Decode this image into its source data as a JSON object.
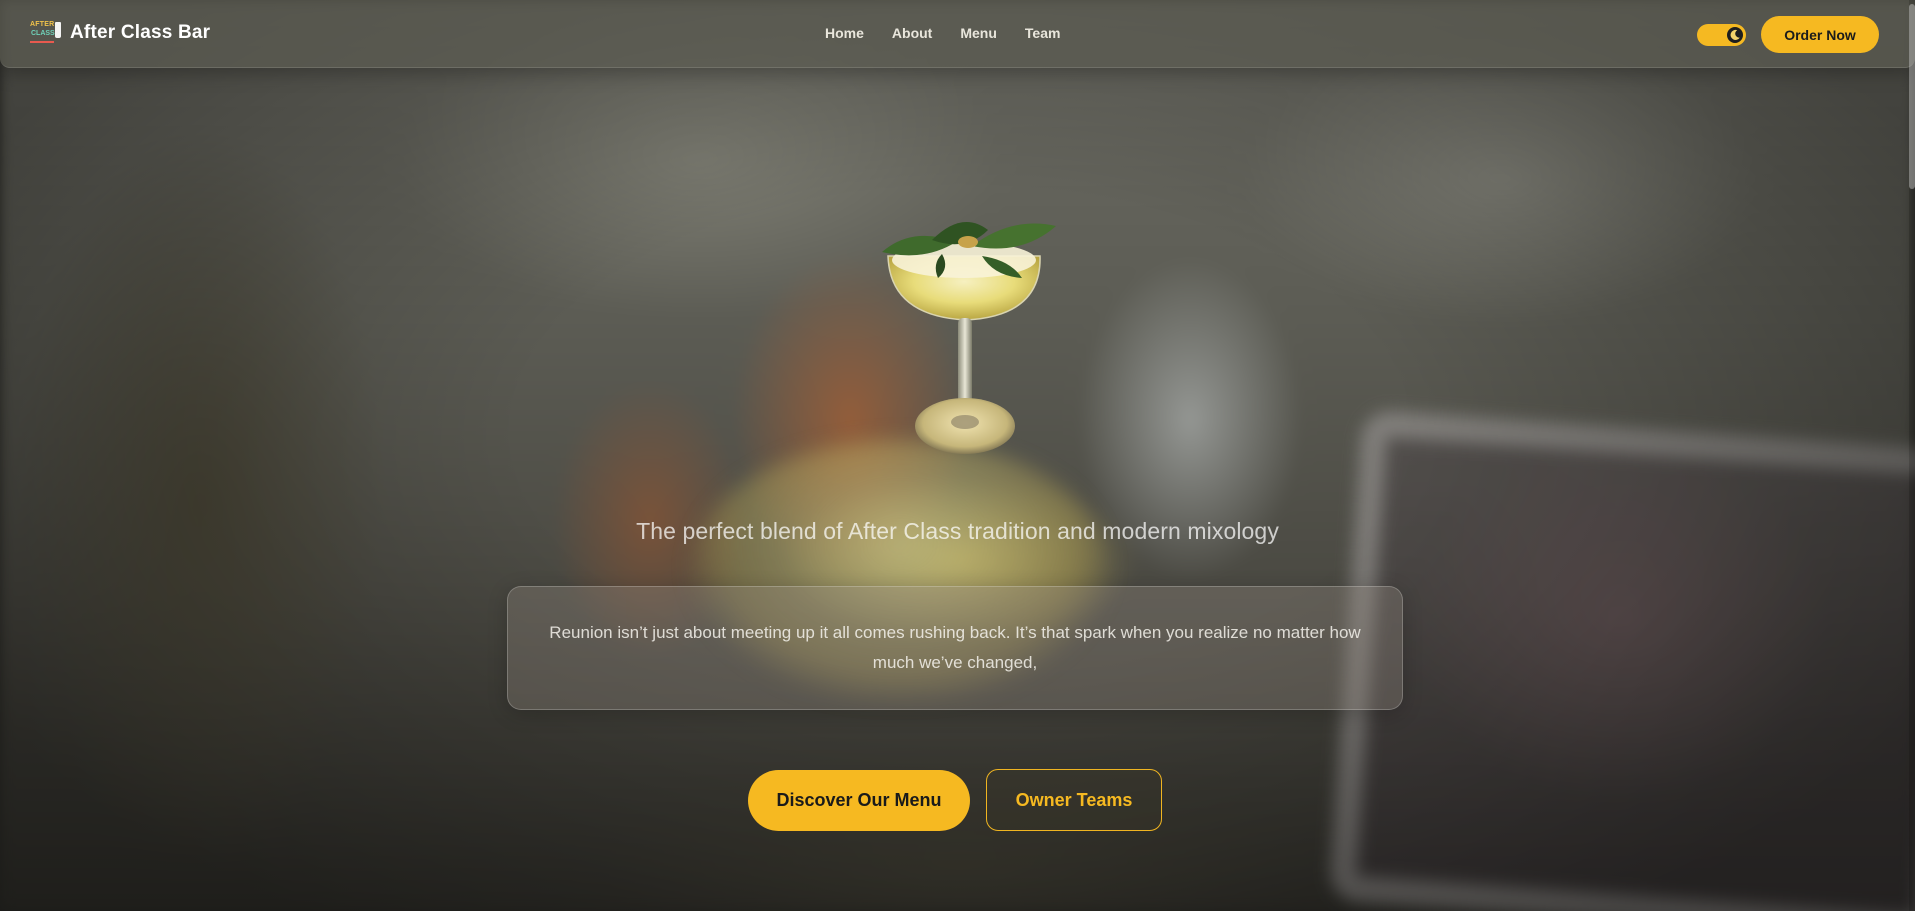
{
  "brand": {
    "name": "After Class Bar",
    "logo_line1": "AFTER",
    "logo_line2": "CLASS"
  },
  "nav": {
    "links": [
      "Home",
      "About",
      "Menu",
      "Team"
    ]
  },
  "header": {
    "theme_toggle_icon": "moon-icon",
    "order_label": "Order Now"
  },
  "hero": {
    "tagline": "The perfect blend of After Class tradition and modern mixology",
    "quote": "Reunion isn’t just about meeting up it all comes rushing back. It’s that spark when you realize no matter how much we’ve changed,",
    "primary_cta": "Discover Our Menu",
    "secondary_cta": "Owner Teams",
    "image_icon": "cocktail-glass-image"
  },
  "colors": {
    "accent": "#f6b921",
    "text_light": "#ffffff"
  }
}
